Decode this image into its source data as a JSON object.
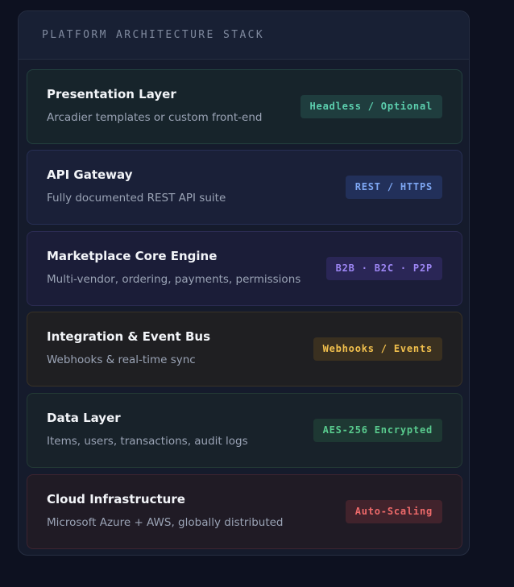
{
  "panel": {
    "title": "PLATFORM ARCHITECTURE STACK"
  },
  "layers": [
    {
      "name": "Presentation Layer",
      "description": "Arcadier templates or custom front-end",
      "badge": "Headless / Optional",
      "badge_color": "#5ccfae"
    },
    {
      "name": "API Gateway",
      "description": "Fully documented REST API suite",
      "badge": "REST / HTTPS",
      "badge_color": "#7ea7f3"
    },
    {
      "name": "Marketplace Core Engine",
      "description": "Multi-vendor, ordering, payments, permissions",
      "badge": "B2B · B2C · P2P",
      "badge_color": "#9d86f4"
    },
    {
      "name": "Integration & Event Bus",
      "description": "Webhooks & real-time sync",
      "badge": "Webhooks / Events",
      "badge_color": "#f2c04d"
    },
    {
      "name": "Data Layer",
      "description": "Items, users, transactions, audit logs",
      "badge": "AES-256 Encrypted",
      "badge_color": "#59cb8e"
    },
    {
      "name": "Cloud Infrastructure",
      "description": "Microsoft Azure + AWS, globally distributed",
      "badge": "Auto-Scaling",
      "badge_color": "#ee6a6a"
    }
  ],
  "colors": {
    "background": "#0d1120",
    "panel": "#151b2c"
  }
}
